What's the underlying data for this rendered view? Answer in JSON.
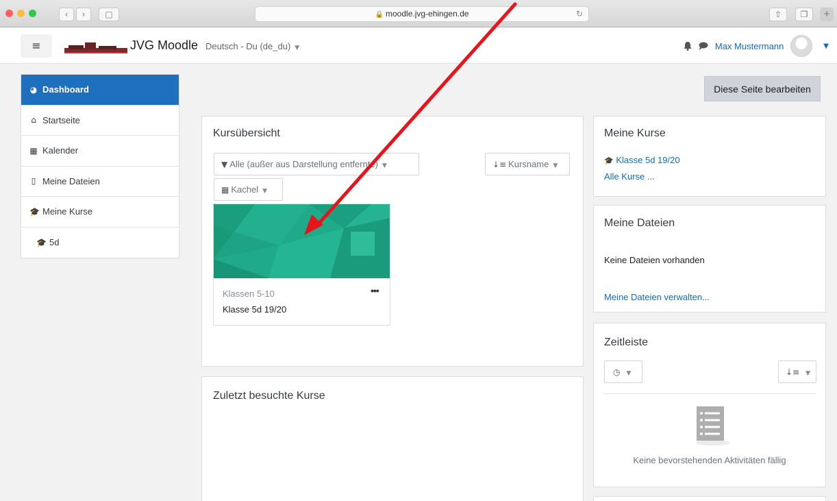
{
  "browser": {
    "url": "moodle.jvg-ehingen.de",
    "back_icon": "‹",
    "forward_icon": "›",
    "sidebar_icon": "▢",
    "reload_icon": "↻",
    "share_icon": "⇧",
    "tabs_icon": "❐",
    "newtab_icon": "+"
  },
  "navbar": {
    "menu_icon": "≡",
    "site_name": "JVG Moodle",
    "language": "Deutsch - Du (de_du)",
    "language_caret": "▼",
    "bell_icon": "🔔",
    "chat_icon": "💬",
    "user_name": "Max Mustermann",
    "user_caret": "▼"
  },
  "sidebar": {
    "items": [
      {
        "label": "Dashboard",
        "icon": "◕",
        "active": true
      },
      {
        "label": "Startseite",
        "icon": "⌂"
      },
      {
        "label": "Kalender",
        "icon": "▦"
      },
      {
        "label": "Meine Dateien",
        "icon": "▯"
      },
      {
        "label": "Meine Kurse",
        "icon": "🎓"
      },
      {
        "label": "5d",
        "icon": "🎓"
      }
    ]
  },
  "page": {
    "edit_button": "Diese Seite bearbeiten"
  },
  "overview": {
    "title": "Kursübersicht",
    "filter_label": "Alle (außer aus Darstellung entfernte)",
    "filter_icon": "▼",
    "sort_label": "Kursname",
    "sort_icon": "↓≡",
    "view_label": "Kachel",
    "view_icon": "▦",
    "course": {
      "category": "Klassen 5-10",
      "name": "Klasse 5d 19/20",
      "menu": "•••"
    }
  },
  "recent": {
    "title": "Zuletzt besuchte Kurse"
  },
  "my_courses": {
    "title": "Meine Kurse",
    "course_link": "Klasse 5d 19/20",
    "all_link": "Alle Kurse ..."
  },
  "my_files": {
    "title": "Meine Dateien",
    "empty": "Keine Dateien vorhanden",
    "manage_link": "Meine Dateien verwalten..."
  },
  "timeline": {
    "title": "Zeitleiste",
    "clock_icon": "◷",
    "sort_icon": "↓≡",
    "empty": "Keine bevorstehenden Aktivitäten fällig"
  },
  "colors": {
    "accent": "#1f6fbf",
    "link": "#0f6cbf",
    "course_image": "#1fab89",
    "annotation_arrow": "#e8141b"
  }
}
